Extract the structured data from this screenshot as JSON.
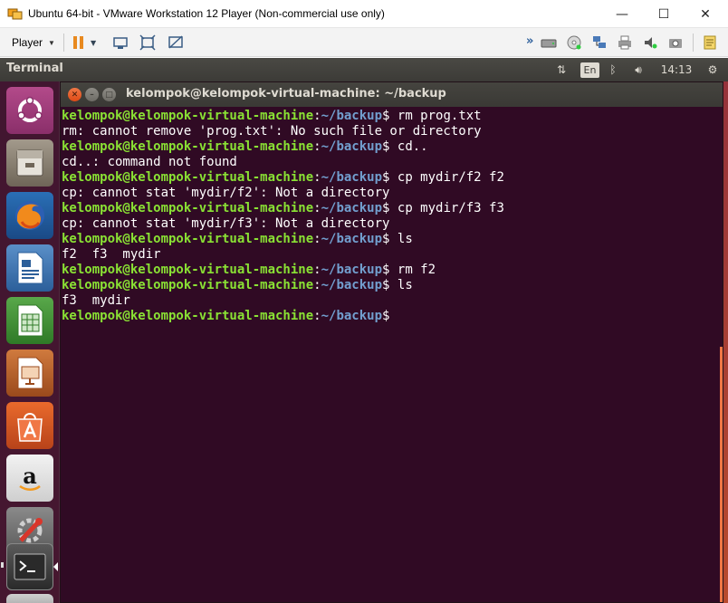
{
  "vmware": {
    "title": "Ubuntu 64-bit - VMware Workstation 12 Player (Non-commercial use only)",
    "player_menu": "Player",
    "window_controls": {
      "minimize": "—",
      "maximize": "☐",
      "close": "✕"
    }
  },
  "ubuntu_panel": {
    "app_title": "Terminal",
    "keyboard_lang": "En",
    "clock": "14:13"
  },
  "terminal": {
    "window_title": "kelompok@kelompok-virtual-machine: ~/backup",
    "prompt_user": "kelompok@kelompok-virtual-machine",
    "prompt_colon": ":",
    "prompt_path": "~/backup",
    "prompt_dollar": "$",
    "lines": [
      {
        "kind": "prompt",
        "cmd": " rm prog.txt"
      },
      {
        "kind": "output",
        "text": "rm: cannot remove 'prog.txt': No such file or directory"
      },
      {
        "kind": "prompt",
        "cmd": " cd.."
      },
      {
        "kind": "output",
        "text": "cd..: command not found"
      },
      {
        "kind": "prompt",
        "cmd": " cp mydir/f2 f2"
      },
      {
        "kind": "output",
        "text": "cp: cannot stat 'mydir/f2': Not a directory"
      },
      {
        "kind": "prompt",
        "cmd": " cp mydir/f3 f3"
      },
      {
        "kind": "output",
        "text": "cp: cannot stat 'mydir/f3': Not a directory"
      },
      {
        "kind": "prompt",
        "cmd": " ls"
      },
      {
        "kind": "output",
        "text": "f2  f3  mydir"
      },
      {
        "kind": "prompt",
        "cmd": " rm f2"
      },
      {
        "kind": "prompt",
        "cmd": " ls"
      },
      {
        "kind": "output",
        "text": "f3  mydir"
      },
      {
        "kind": "prompt",
        "cmd": ""
      }
    ]
  },
  "launcher": {
    "items": [
      {
        "name": "ubuntu-dash-icon"
      },
      {
        "name": "files-icon"
      },
      {
        "name": "firefox-icon"
      },
      {
        "name": "libreoffice-writer-icon"
      },
      {
        "name": "libreoffice-calc-icon"
      },
      {
        "name": "libreoffice-impress-icon"
      },
      {
        "name": "ubuntu-software-icon"
      },
      {
        "name": "amazon-icon"
      },
      {
        "name": "system-settings-icon"
      },
      {
        "name": "terminal-icon"
      }
    ]
  },
  "colors": {
    "terminal_bg": "#300a24",
    "prompt_user": "#8ae234",
    "prompt_path": "#729fcf",
    "accent": "#f07746"
  }
}
